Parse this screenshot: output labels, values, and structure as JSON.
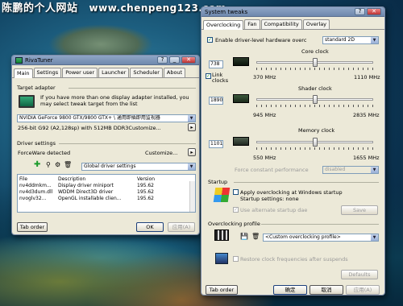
{
  "watermark": {
    "site_name": "陈鹏的个人网站",
    "url": "www.chenpeng123.com"
  },
  "rivatuner": {
    "title": "RivaTuner",
    "tabs": [
      "Main",
      "Settings",
      "Power user",
      "Launcher",
      "Scheduler",
      "About"
    ],
    "target_adapter_label": "Target adapter",
    "adapter_info": "If you have more than one display adapter installed, you may select tweak target from the list",
    "adapter_select": "NVIDIA GeForce 9800 GTX/9800 GTX+ \\ 通用即插即用监视器",
    "adapter_desc": "256-bit G92 (A2,128sp) with 512MB DDR3Customize...",
    "driver_settings_label": "Driver settings",
    "driver_status": "ForceWare detected",
    "customize_label": "Customize...",
    "driver_profile_select": "Global driver settings",
    "file_table": {
      "columns": [
        "File",
        "Description",
        "Version"
      ],
      "rows": [
        [
          "nv4ddmkm...",
          "Display driver miniport",
          "195.62"
        ],
        [
          "nv4d3dum.dll",
          "WDDM Direct3D driver",
          "195.62"
        ],
        [
          "nvoglv32...",
          "OpenGL installable clien...",
          "195.62"
        ]
      ]
    },
    "tab_order": "Tab order",
    "ok": "OK",
    "apply": "应用(A)"
  },
  "tweaks": {
    "title": "System tweaks",
    "tabs": [
      "Overclocking",
      "Fan",
      "Compatibility",
      "Overlay"
    ],
    "enable_label": "Enable driver-level hardware overc",
    "mode_select": "standard 2D",
    "core_clock_label": "Core clock",
    "core_value": "738",
    "core_min": "370 MHz",
    "core_max": "1110 MHz",
    "core_fraction": 0.5,
    "link_clocks": "Link clocks",
    "shader_clock_label": "Shader clock",
    "shader_value": "1890",
    "shader_min": "945 MHz",
    "shader_max": "2835 MHz",
    "shader_fraction": 0.5,
    "memory_clock_label": "Memory clock",
    "memory_value": "1101",
    "memory_min": "550 MHz",
    "memory_max": "1655 MHz",
    "memory_fraction": 0.5,
    "fcp_label": "Force constant performance",
    "fcp_select": "disabled",
    "startup_label": "Startup",
    "apply_startup": "Apply overclocking at Windows startup",
    "startup_settings": "Startup settings: none",
    "use_alt": "Use alternate startup dae",
    "save": "Save",
    "profile_label": "Overclocking profile",
    "profile_select": "<Custom overclocking profile>",
    "restore": "Restore clock frequencies after suspends",
    "defaults": "Defaults",
    "tab_order": "Tab order",
    "ok": "确定",
    "cancel": "取消",
    "apply": "应用(A)"
  }
}
